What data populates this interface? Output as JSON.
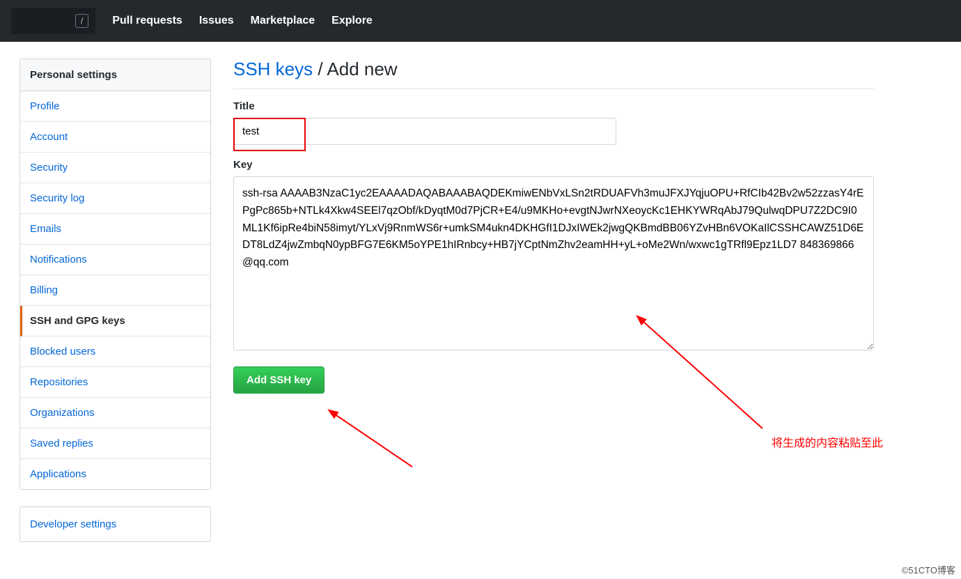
{
  "nav": {
    "slash_key": "/",
    "items": [
      "Pull requests",
      "Issues",
      "Marketplace",
      "Explore"
    ]
  },
  "sidebar": {
    "header": "Personal settings",
    "items": [
      {
        "label": "Profile",
        "active": false
      },
      {
        "label": "Account",
        "active": false
      },
      {
        "label": "Security",
        "active": false
      },
      {
        "label": "Security log",
        "active": false
      },
      {
        "label": "Emails",
        "active": false
      },
      {
        "label": "Notifications",
        "active": false
      },
      {
        "label": "Billing",
        "active": false
      },
      {
        "label": "SSH and GPG keys",
        "active": true
      },
      {
        "label": "Blocked users",
        "active": false
      },
      {
        "label": "Repositories",
        "active": false
      },
      {
        "label": "Organizations",
        "active": false
      },
      {
        "label": "Saved replies",
        "active": false
      },
      {
        "label": "Applications",
        "active": false
      }
    ],
    "secondary": [
      {
        "label": "Developer settings"
      }
    ]
  },
  "page": {
    "title_link": "SSH keys",
    "title_sep": " / ",
    "title_rest": "Add new",
    "title_label": "Title",
    "title_value": "test",
    "key_label": "Key",
    "key_value": "ssh-rsa AAAAB3NzaC1yc2EAAAADAQABAAABAQDEKmiwENbVxLSn2tRDUAFVh3muJFXJYqjuOPU+RfCIb42Bv2w52zzasY4rEPgPc865b+NTLk4Xkw4SEEl7qzObf/kDyqtM0d7PjCR+E4/u9MKHo+evgtNJwrNXeoycKc1EHKYWRqAbJ79QulwqDPU7Z2DC9I0ML1Kf6ipRe4biN58imyt/YLxVj9RnmWS6r+umkSM4ukn4DKHGfI1DJxIWEk2jwgQKBmdBB06YZvHBn6VOKaIlCSSHCAWZ51D6EDT8LdZ4jwZmbqN0ypBFG7E6KM5oYPE1hIRnbcy+HB7jYCptNmZhv2eamHH+yL+oMe2Wn/wxwc1gTRfl9Epz1LD7 848369866@qq.com",
    "submit_label": "Add SSH key"
  },
  "annotations": {
    "note": "将生成的内容粘贴至此"
  },
  "watermark": "©51CTO博客"
}
